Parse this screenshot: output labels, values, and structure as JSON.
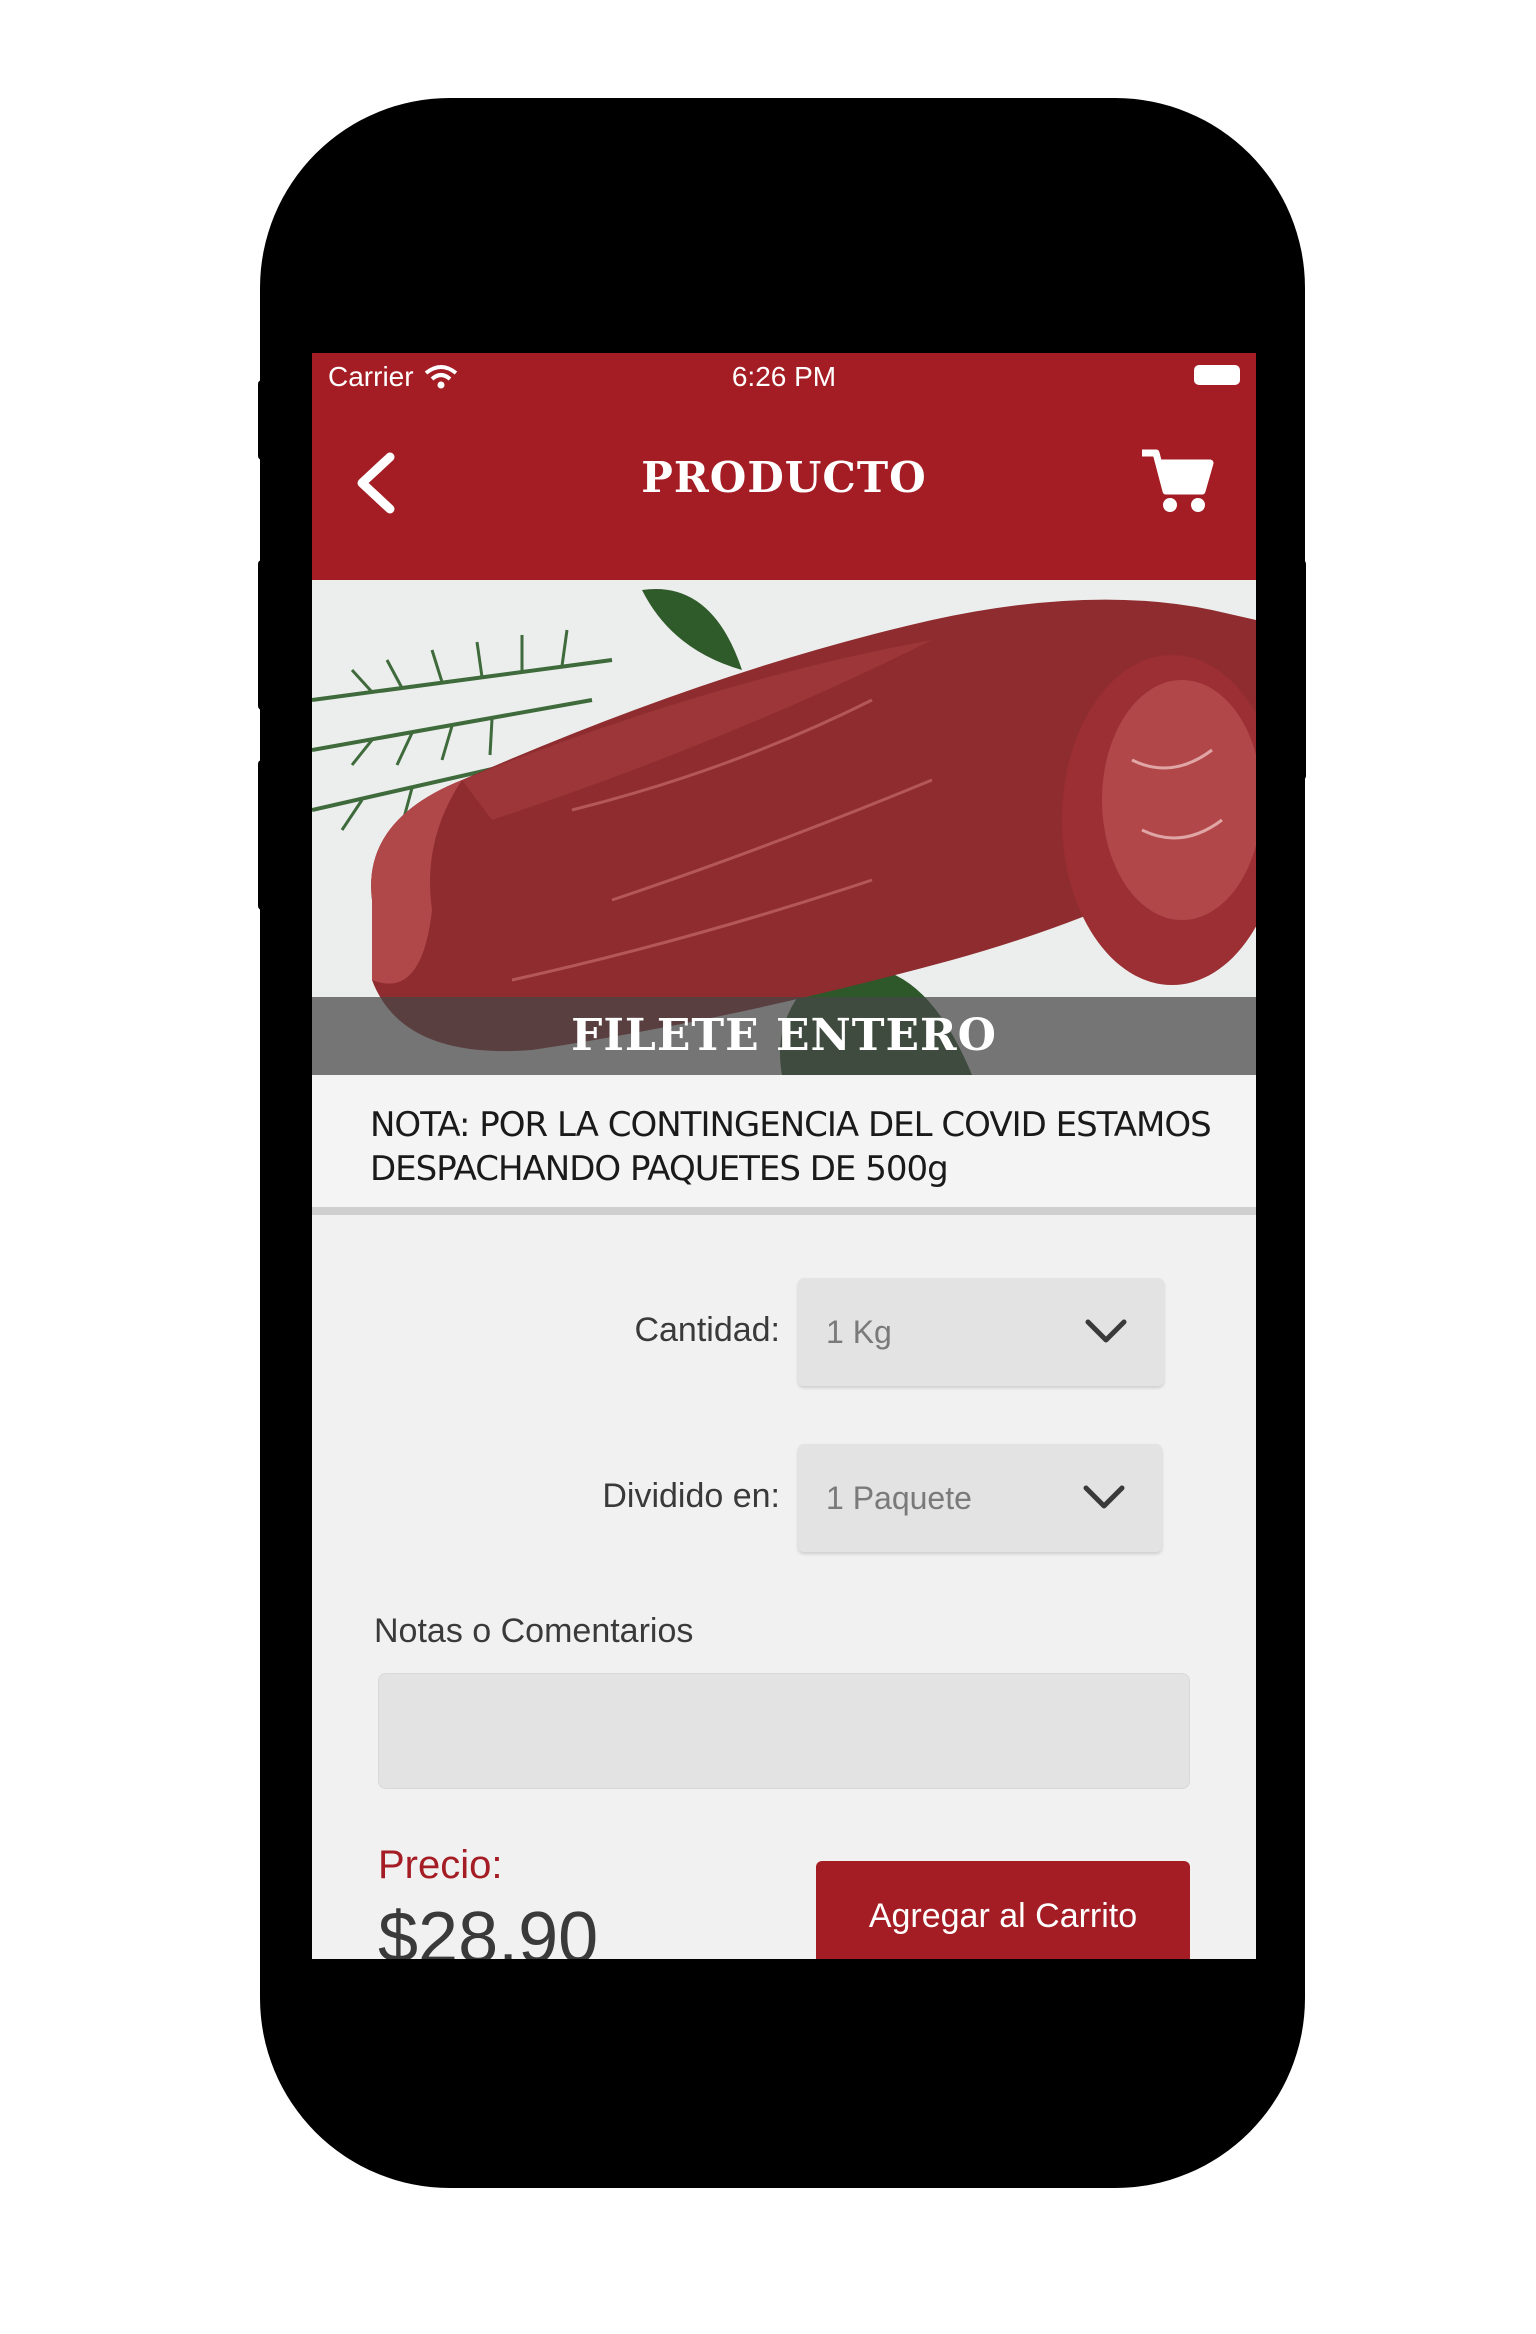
{
  "status_bar": {
    "carrier": "Carrier",
    "time": "6:26 PM"
  },
  "nav": {
    "title": "PRODUCTO",
    "back_icon": "chevron-left-icon",
    "cart_icon": "cart-icon"
  },
  "product": {
    "name": "FILETE ENTERO",
    "note": "NOTA: POR LA CONTINGENCIA DEL COVID ESTAMOS DESPACHANDO PAQUETES DE 500g"
  },
  "form": {
    "quantity_label": "Cantidad:",
    "quantity_value": "1 Kg",
    "divided_label": "Dividido en:",
    "divided_value": "1 Paquete",
    "notes_label": "Notas o Comentarios",
    "notes_value": ""
  },
  "price": {
    "label": "Precio:",
    "value": "$28.90"
  },
  "actions": {
    "add_to_cart": "Agregar al Carrito"
  },
  "colors": {
    "brand_red": "#a51d24",
    "background": "#f1f1f1"
  }
}
